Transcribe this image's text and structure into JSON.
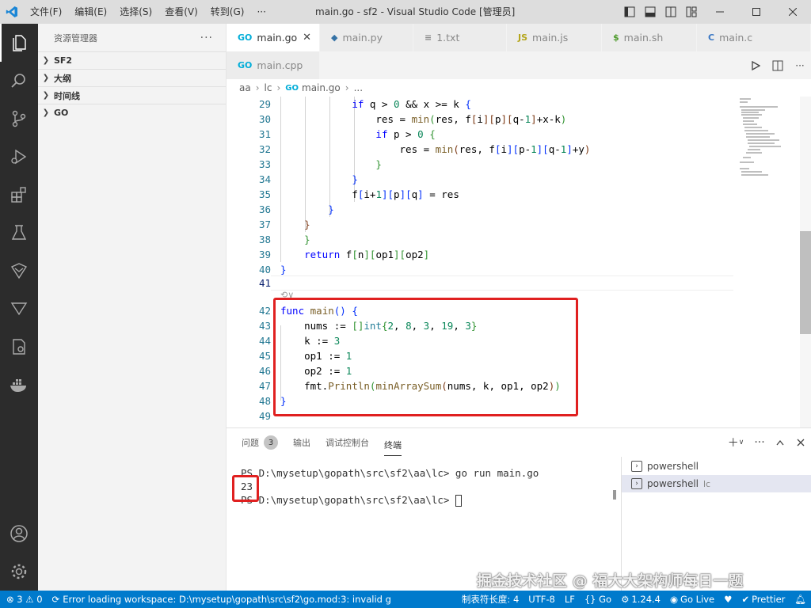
{
  "window": {
    "title": "main.go - sf2 - Visual Studio Code [管理员]",
    "menu": [
      "文件(F)",
      "编辑(E)",
      "选择(S)",
      "查看(V)",
      "转到(G)",
      "···"
    ]
  },
  "activity_bar": [
    "explorer-icon",
    "search-icon",
    "source-control-icon",
    "run-debug-icon",
    "extensions-icon",
    "testing-icon",
    "remote-icon",
    "filter-icon",
    "settings-sync-icon",
    "docker-icon",
    "account-icon",
    "gear-icon"
  ],
  "sidebar": {
    "header": "资源管理器",
    "more": "···",
    "sections": [
      "SF2",
      "大纲",
      "时间线",
      "GO"
    ]
  },
  "tabs": [
    {
      "label": "main.go",
      "icon": "GO",
      "color": "#00add8",
      "active": true
    },
    {
      "label": "main.py",
      "icon": "◆",
      "color": "#3572a5",
      "active": false
    },
    {
      "label": "1.txt",
      "icon": "≡",
      "color": "#888888",
      "active": false
    },
    {
      "label": "main.js",
      "icon": "JS",
      "color": "#cbcb41",
      "active": false
    },
    {
      "label": "main.sh",
      "icon": "$",
      "color": "#4d9a2b",
      "active": false
    },
    {
      "label": "main.c",
      "icon": "C",
      "color": "#3b78c4",
      "active": false
    },
    {
      "label": "main.cpp",
      "icon": "GO",
      "color": "#00add8",
      "active": false
    }
  ],
  "breadcrumb": [
    "aa",
    "lc",
    "main.go",
    "..."
  ],
  "editor": {
    "line_numbers": [
      "29",
      "30",
      "31",
      "32",
      "33",
      "34",
      "35",
      "36",
      "37",
      "38",
      "39",
      "40",
      "41",
      "42",
      "43",
      "44",
      "45",
      "46",
      "47",
      "48",
      "49"
    ],
    "current_line": "41",
    "codelens": "⟲∨"
  },
  "panel": {
    "tabs": [
      "问题",
      "输出",
      "调试控制台",
      "终端"
    ],
    "problems_badge": "3",
    "active_tab": "终端",
    "terminal_lines": [
      "PS D:\\mysetup\\gopath\\src\\sf2\\aa\\lc> go run main.go",
      "23",
      "PS D:\\mysetup\\gopath\\src\\sf2\\aa\\lc> "
    ],
    "terminals": [
      {
        "label": "powershell",
        "sub": ""
      },
      {
        "label": "powershell",
        "sub": "lc"
      }
    ],
    "watermark": "掘金技术社区 @ 福大大架构师每日一题"
  },
  "statusbar": {
    "problems": "⊗ 3 ⚠ 0",
    "error": "Error loading workspace: D:\\mysetup\\gopath\\src\\sf2\\go.mod:3: invalid g",
    "tab_size": "制表符长度: 4",
    "encoding": "UTF-8",
    "eol": "LF",
    "language": "{} Go",
    "go_version": "1.24.4",
    "golive": "Go Live",
    "prettier": "Prettier"
  },
  "colors": {
    "statusbar": "#007acc",
    "highlight": "#e02020",
    "activity_bar": "#2c2c2c"
  }
}
